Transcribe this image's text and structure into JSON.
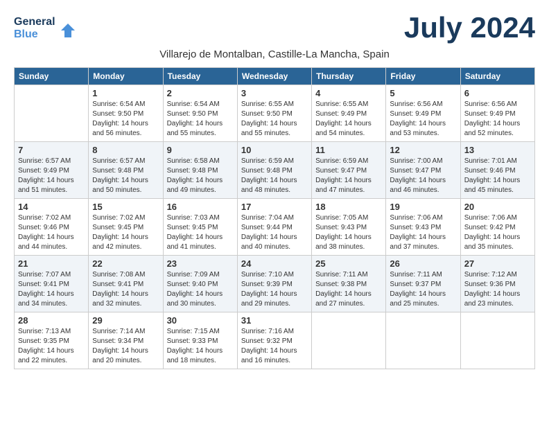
{
  "header": {
    "logo_line1": "General",
    "logo_line2": "Blue",
    "month_title": "July 2024",
    "location": "Villarejo de Montalban, Castille-La Mancha, Spain"
  },
  "calendar": {
    "weekdays": [
      "Sunday",
      "Monday",
      "Tuesday",
      "Wednesday",
      "Thursday",
      "Friday",
      "Saturday"
    ],
    "weeks": [
      [
        {
          "day": "",
          "info": ""
        },
        {
          "day": "1",
          "info": "Sunrise: 6:54 AM\nSunset: 9:50 PM\nDaylight: 14 hours and 56 minutes."
        },
        {
          "day": "2",
          "info": "Sunrise: 6:54 AM\nSunset: 9:50 PM\nDaylight: 14 hours and 55 minutes."
        },
        {
          "day": "3",
          "info": "Sunrise: 6:55 AM\nSunset: 9:50 PM\nDaylight: 14 hours and 55 minutes."
        },
        {
          "day": "4",
          "info": "Sunrise: 6:55 AM\nSunset: 9:49 PM\nDaylight: 14 hours and 54 minutes."
        },
        {
          "day": "5",
          "info": "Sunrise: 6:56 AM\nSunset: 9:49 PM\nDaylight: 14 hours and 53 minutes."
        },
        {
          "day": "6",
          "info": "Sunrise: 6:56 AM\nSunset: 9:49 PM\nDaylight: 14 hours and 52 minutes."
        }
      ],
      [
        {
          "day": "7",
          "info": "Sunrise: 6:57 AM\nSunset: 9:49 PM\nDaylight: 14 hours and 51 minutes."
        },
        {
          "day": "8",
          "info": "Sunrise: 6:57 AM\nSunset: 9:48 PM\nDaylight: 14 hours and 50 minutes."
        },
        {
          "day": "9",
          "info": "Sunrise: 6:58 AM\nSunset: 9:48 PM\nDaylight: 14 hours and 49 minutes."
        },
        {
          "day": "10",
          "info": "Sunrise: 6:59 AM\nSunset: 9:48 PM\nDaylight: 14 hours and 48 minutes."
        },
        {
          "day": "11",
          "info": "Sunrise: 6:59 AM\nSunset: 9:47 PM\nDaylight: 14 hours and 47 minutes."
        },
        {
          "day": "12",
          "info": "Sunrise: 7:00 AM\nSunset: 9:47 PM\nDaylight: 14 hours and 46 minutes."
        },
        {
          "day": "13",
          "info": "Sunrise: 7:01 AM\nSunset: 9:46 PM\nDaylight: 14 hours and 45 minutes."
        }
      ],
      [
        {
          "day": "14",
          "info": "Sunrise: 7:02 AM\nSunset: 9:46 PM\nDaylight: 14 hours and 44 minutes."
        },
        {
          "day": "15",
          "info": "Sunrise: 7:02 AM\nSunset: 9:45 PM\nDaylight: 14 hours and 42 minutes."
        },
        {
          "day": "16",
          "info": "Sunrise: 7:03 AM\nSunset: 9:45 PM\nDaylight: 14 hours and 41 minutes."
        },
        {
          "day": "17",
          "info": "Sunrise: 7:04 AM\nSunset: 9:44 PM\nDaylight: 14 hours and 40 minutes."
        },
        {
          "day": "18",
          "info": "Sunrise: 7:05 AM\nSunset: 9:43 PM\nDaylight: 14 hours and 38 minutes."
        },
        {
          "day": "19",
          "info": "Sunrise: 7:06 AM\nSunset: 9:43 PM\nDaylight: 14 hours and 37 minutes."
        },
        {
          "day": "20",
          "info": "Sunrise: 7:06 AM\nSunset: 9:42 PM\nDaylight: 14 hours and 35 minutes."
        }
      ],
      [
        {
          "day": "21",
          "info": "Sunrise: 7:07 AM\nSunset: 9:41 PM\nDaylight: 14 hours and 34 minutes."
        },
        {
          "day": "22",
          "info": "Sunrise: 7:08 AM\nSunset: 9:41 PM\nDaylight: 14 hours and 32 minutes."
        },
        {
          "day": "23",
          "info": "Sunrise: 7:09 AM\nSunset: 9:40 PM\nDaylight: 14 hours and 30 minutes."
        },
        {
          "day": "24",
          "info": "Sunrise: 7:10 AM\nSunset: 9:39 PM\nDaylight: 14 hours and 29 minutes."
        },
        {
          "day": "25",
          "info": "Sunrise: 7:11 AM\nSunset: 9:38 PM\nDaylight: 14 hours and 27 minutes."
        },
        {
          "day": "26",
          "info": "Sunrise: 7:11 AM\nSunset: 9:37 PM\nDaylight: 14 hours and 25 minutes."
        },
        {
          "day": "27",
          "info": "Sunrise: 7:12 AM\nSunset: 9:36 PM\nDaylight: 14 hours and 23 minutes."
        }
      ],
      [
        {
          "day": "28",
          "info": "Sunrise: 7:13 AM\nSunset: 9:35 PM\nDaylight: 14 hours and 22 minutes."
        },
        {
          "day": "29",
          "info": "Sunrise: 7:14 AM\nSunset: 9:34 PM\nDaylight: 14 hours and 20 minutes."
        },
        {
          "day": "30",
          "info": "Sunrise: 7:15 AM\nSunset: 9:33 PM\nDaylight: 14 hours and 18 minutes."
        },
        {
          "day": "31",
          "info": "Sunrise: 7:16 AM\nSunset: 9:32 PM\nDaylight: 14 hours and 16 minutes."
        },
        {
          "day": "",
          "info": ""
        },
        {
          "day": "",
          "info": ""
        },
        {
          "day": "",
          "info": ""
        }
      ]
    ]
  }
}
